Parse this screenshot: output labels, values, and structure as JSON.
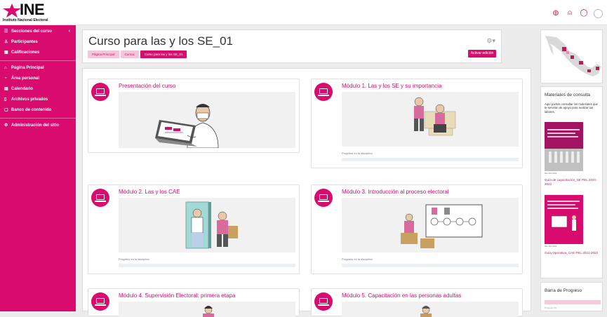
{
  "brand": {
    "logo_word": "INE",
    "logo_subtitle": "Instituto Nacional Electoral",
    "accent": "#d90b6f"
  },
  "topbar": {
    "icons": [
      "grid-icon",
      "bell-icon",
      "chat-icon",
      "avatar"
    ]
  },
  "sidebar": {
    "items": [
      {
        "label": "Secciones del curso",
        "icon": "sections-icon"
      },
      {
        "label": "Participantes",
        "icon": "participants-icon"
      },
      {
        "label": "Calificaciones",
        "icon": "grades-icon"
      },
      {
        "label": "Página Principal",
        "icon": "home-icon"
      },
      {
        "label": "Área personal",
        "icon": "dashboard-icon"
      },
      {
        "label": "Calendario",
        "icon": "calendar-icon"
      },
      {
        "label": "Archivos privados",
        "icon": "files-icon"
      },
      {
        "label": "Banco de contenido",
        "icon": "content-bank-icon"
      },
      {
        "label": "Administración del sitio",
        "icon": "admin-icon"
      }
    ]
  },
  "header": {
    "title": "Curso para las y los SE_01",
    "breadcrumb": [
      "Página Principal",
      "Cursos",
      "Curso para las y los SE_01"
    ],
    "edit_button": "Activar edición"
  },
  "modules": [
    {
      "title": "Presentación del curso",
      "progress_label": "",
      "progress": null
    },
    {
      "title": "Módulo 1. Las y los SE y su importancia",
      "progress_label": "Progreso en la disciplina",
      "progress": 0
    },
    {
      "title": "Módulo 2. Las y los CAE",
      "progress_label": "Progreso en la disciplina",
      "progress": 0
    },
    {
      "title": "Módulo 3. Introducción al proceso electoral",
      "progress_label": "Progreso en la disciplina",
      "progress": 0
    },
    {
      "title": "Módulo 4. Supervisión Electoral: primera etapa",
      "progress_label": "",
      "progress": null
    },
    {
      "title": "Módulo 5. Capacitación en las personas adultas",
      "progress_label": "",
      "progress": null
    }
  ],
  "materials": {
    "title": "Materiales de consulta",
    "description": "Aquí podrás consultar los materiales que te servirán de apoyo para realizar tus labores.",
    "items": [
      {
        "link": "Guía de capacitación_SE PEL 2021-2022",
        "cover_text": "Guía de capacitación para la y el Supervisor Electoral",
        "footer": "PEL 2021-2022"
      },
      {
        "link": "Guía Operativa_CAE PEL 2021-2022",
        "cover_text": "Guía Operativa para la y el Capacitador-Asistente Electoral",
        "footer": "PEL 2021-2022"
      }
    ]
  },
  "progress_block": {
    "title": "Barra de Progreso",
    "caption": "Progreso 0%",
    "value": 0
  }
}
